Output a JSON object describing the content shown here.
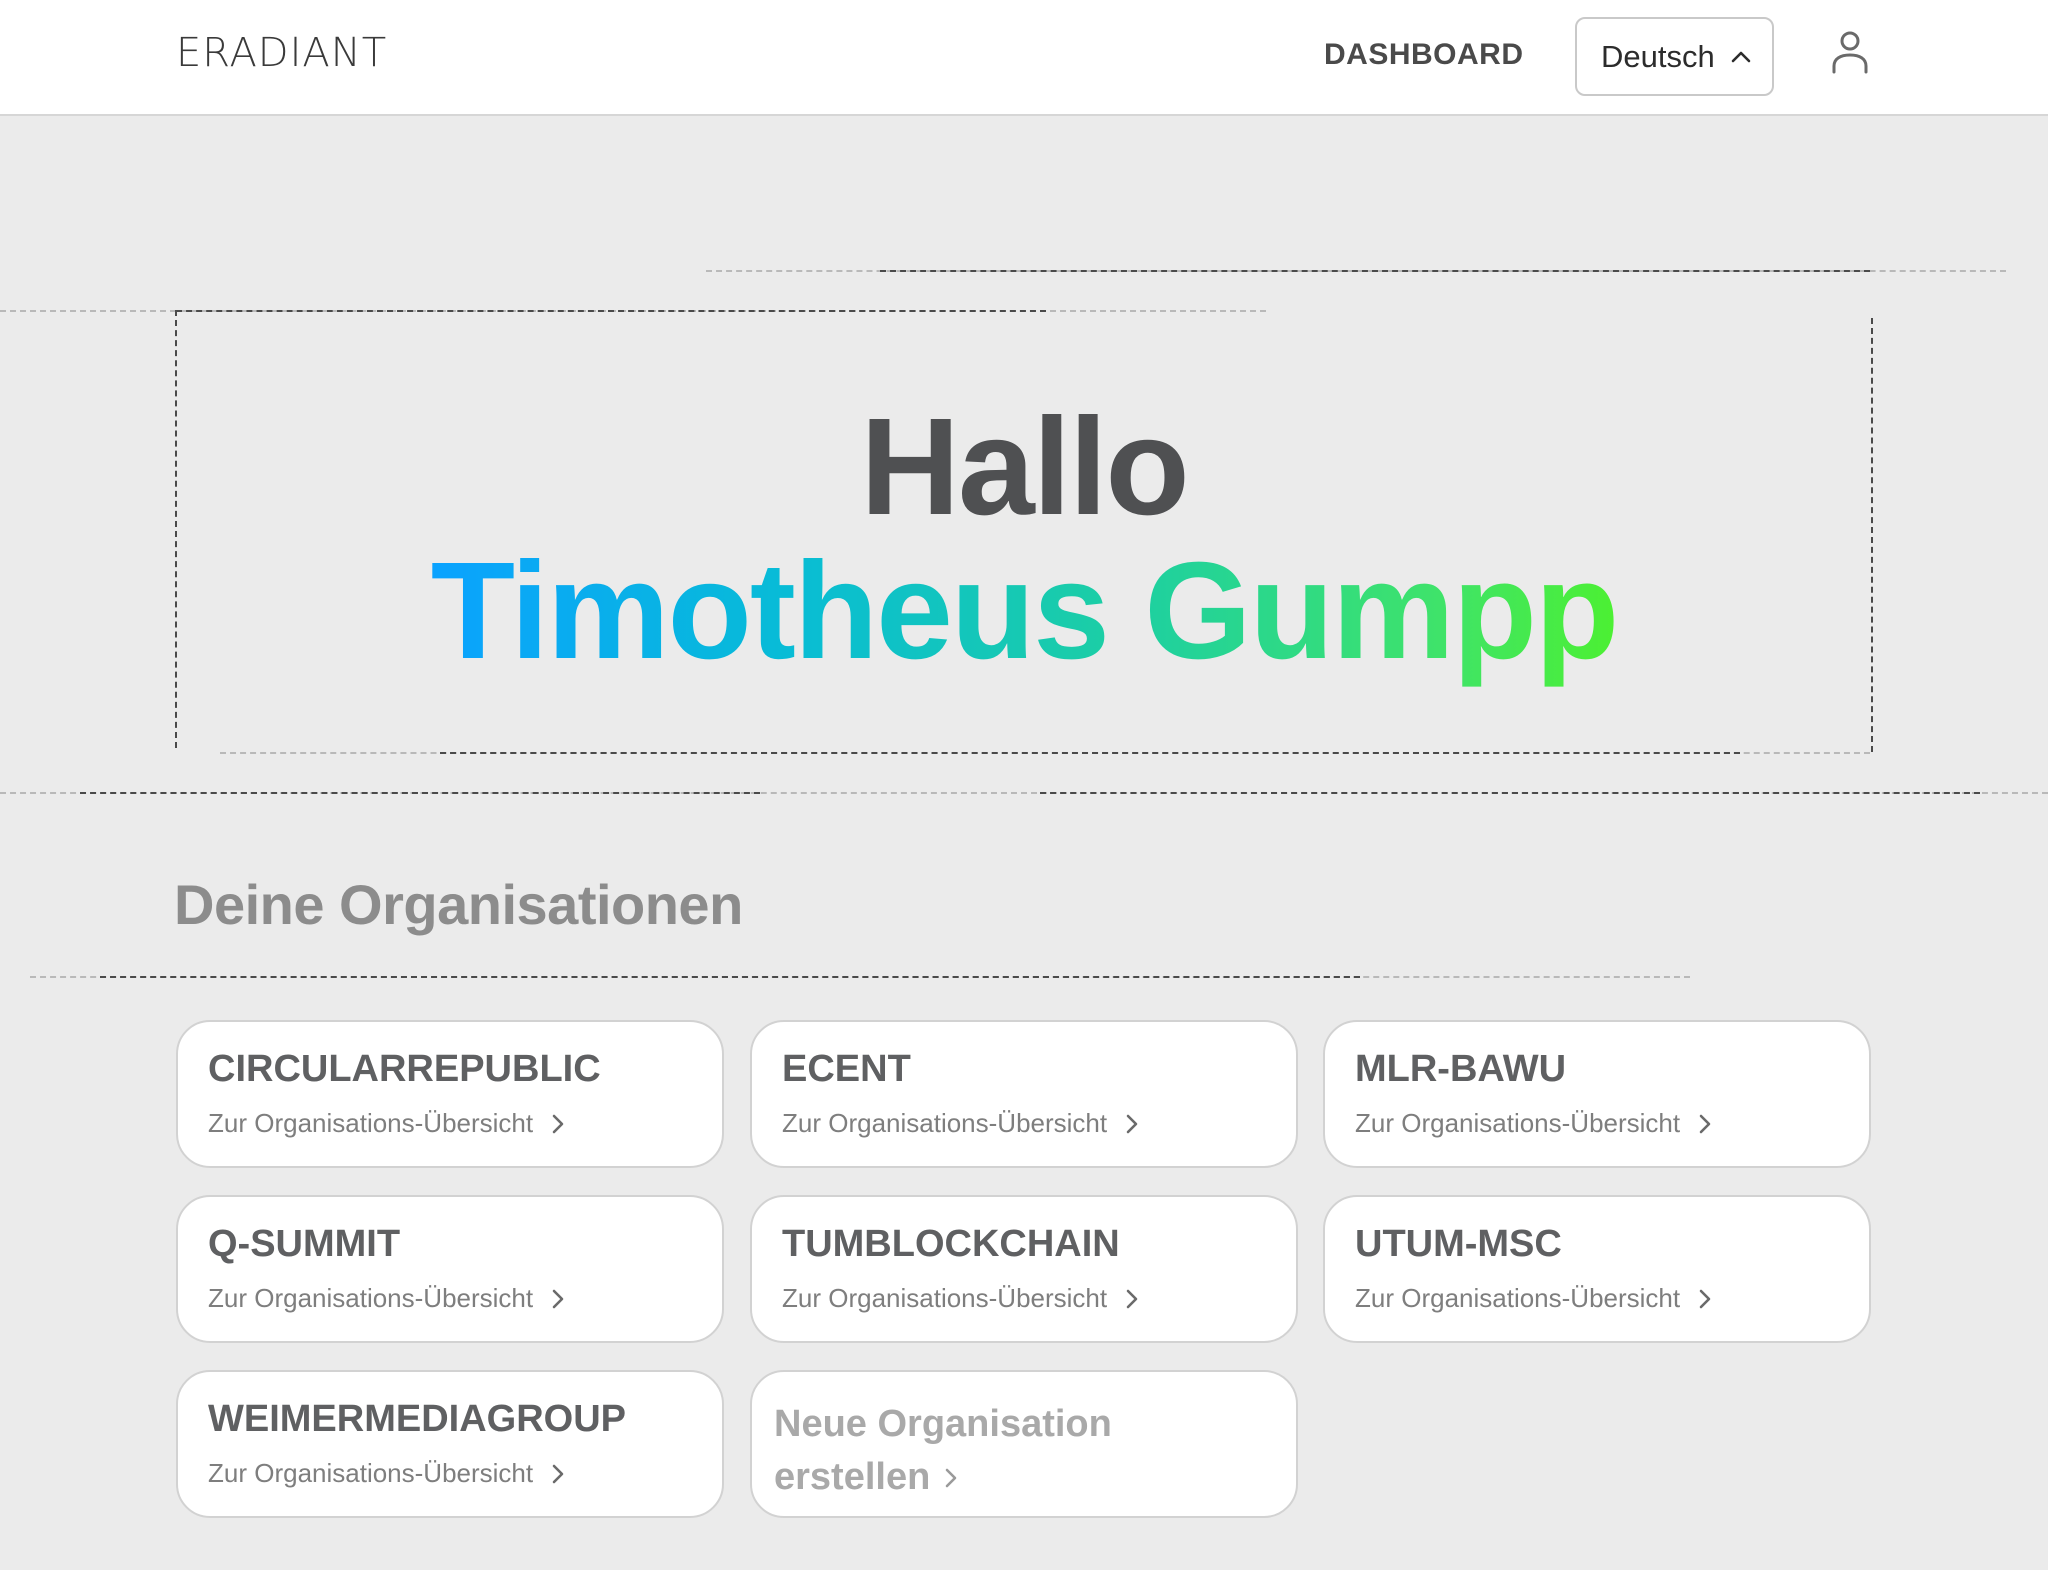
{
  "header": {
    "logo": "ERADIANT",
    "nav_dashboard": "DASHBOARD",
    "language": "Deutsch",
    "user_icon": "user-icon"
  },
  "greeting": {
    "hello": "Hallo",
    "name": "Timotheus Gumpp",
    "gradient": [
      "#0aa2ff",
      "#4cf032"
    ]
  },
  "organisations": {
    "title": "Deine Organisationen",
    "items": [
      {
        "name": "CIRCULARREPUBLIC",
        "link": "Zur Organisations-Übersicht"
      },
      {
        "name": "ECENT",
        "link": "Zur Organisations-Übersicht"
      },
      {
        "name": "MLR-BAWU",
        "link": "Zur Organisations-Übersicht"
      },
      {
        "name": "Q-SUMMIT",
        "link": "Zur Organisations-Übersicht"
      },
      {
        "name": "TUMBLOCKCHAIN",
        "link": "Zur Organisations-Übersicht"
      },
      {
        "name": "UTUM-MSC",
        "link": "Zur Organisations-Übersicht"
      },
      {
        "name": "WEIMERMEDIAGROUP",
        "link": "Zur Organisations-Übersicht"
      }
    ],
    "new_line1": "Neue Organisation",
    "new_line2": "erstellen"
  },
  "colors": {
    "background": "#ebebeb",
    "header": "#ffffff",
    "card": "#ffffff",
    "title_gray": "#4f5052",
    "section_gray": "#8c8c8c"
  }
}
